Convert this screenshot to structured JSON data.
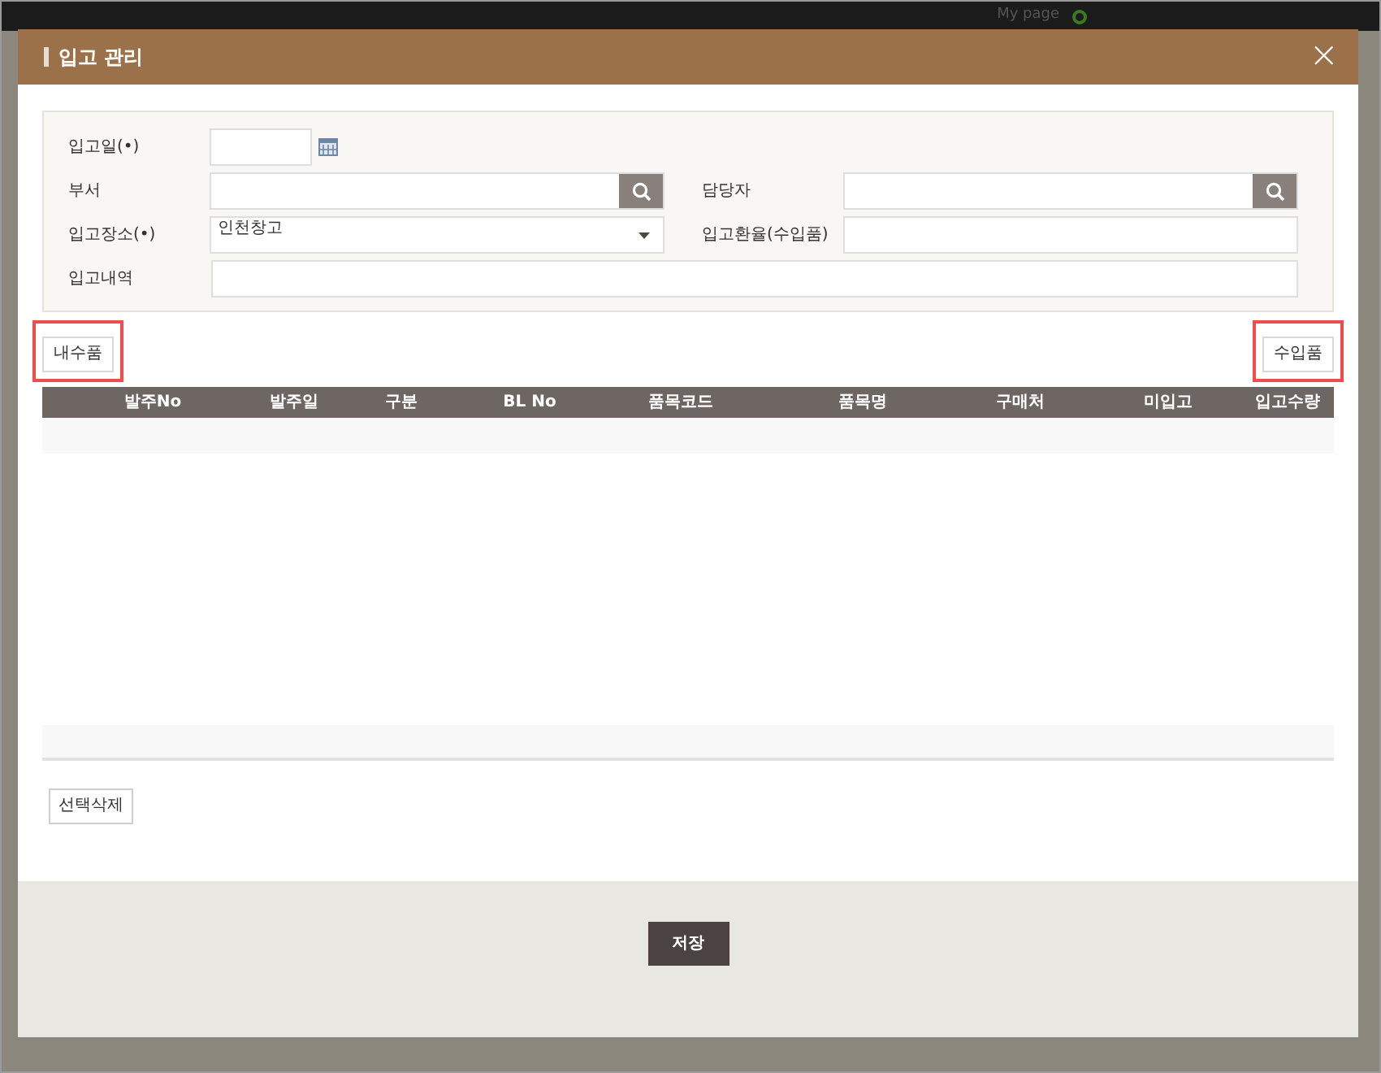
{
  "background": {
    "top_bar": {
      "link": "My page"
    }
  },
  "dialog": {
    "title": "입고 관리",
    "close": "×"
  },
  "form": {
    "fields": [
      {
        "kind": "date",
        "label": "입고일(•)"
      },
      {
        "kind": "search",
        "label": "부서"
      },
      {
        "kind": "search",
        "label": "담당자"
      },
      {
        "kind": "select",
        "label": "입고장소(•)",
        "value": "인천창고"
      },
      {
        "kind": "text",
        "label": "입고환율(수입품)"
      },
      {
        "kind": "wide",
        "label": "입고내역"
      }
    ]
  },
  "type_buttons": [
    {
      "label": "내수품",
      "highlighted": true
    },
    {
      "label": "수입품",
      "highlighted": true
    }
  ],
  "table": {
    "columns": [
      "발주No",
      "발주일",
      "구분",
      "BL No",
      "품목코드",
      "품목명",
      "구매처",
      "미입고",
      "입고수량"
    ]
  },
  "delete_button": "선택삭제",
  "save_button": "저장"
}
